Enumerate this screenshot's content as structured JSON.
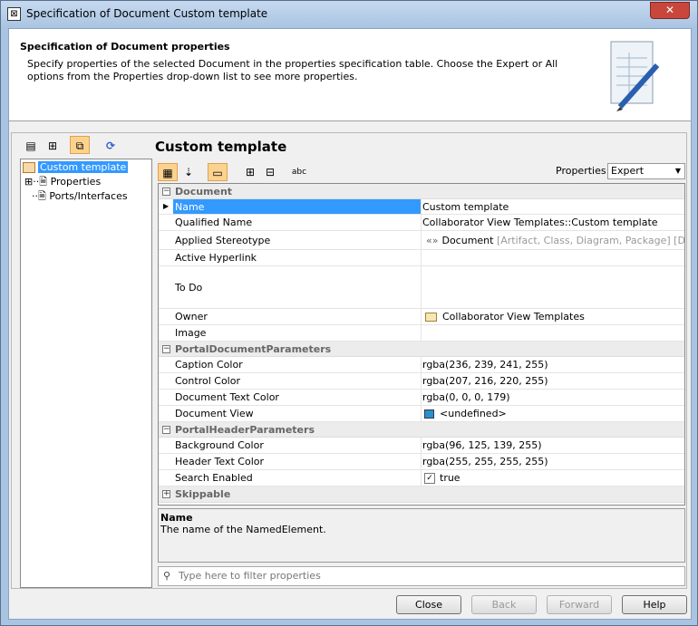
{
  "window": {
    "title": "Specification of Document Custom template",
    "close": "✕"
  },
  "header": {
    "title": "Specification of Document properties",
    "description": "Specify properties of the selected Document in the properties specification table. Choose the Expert or All options from the Properties drop-down list to see more properties."
  },
  "tree": {
    "items": [
      {
        "label": "Custom template"
      },
      {
        "label": "Properties"
      },
      {
        "label": "Ports/Interfaces"
      }
    ]
  },
  "panel": {
    "title": "Custom template",
    "properties_label": "Properties:",
    "properties_value": "Expert"
  },
  "groups": {
    "document": {
      "label": "Document",
      "rows": [
        {
          "name": "Name",
          "value": "Custom template"
        },
        {
          "name": "Qualified Name",
          "value": "Collaborator View Templates::Custom template"
        },
        {
          "name": "Applied Stereotype",
          "value": "Document",
          "value_extra": "[Artifact, Class, Diagram, Package] [Document]"
        },
        {
          "name": "Active Hyperlink",
          "value": ""
        },
        {
          "name": "To Do",
          "value": ""
        },
        {
          "name": "Owner",
          "value": "Collaborator View Templates"
        },
        {
          "name": "Image",
          "value": ""
        }
      ]
    },
    "portal_doc": {
      "label": "PortalDocumentParameters",
      "rows": [
        {
          "name": "Caption Color",
          "value": "rgba(236, 239, 241, 255)"
        },
        {
          "name": "Control Color",
          "value": "rgba(207, 216, 220, 255)"
        },
        {
          "name": "Document Text Color",
          "value": "rgba(0, 0, 0, 179)"
        },
        {
          "name": "Document View",
          "value": "<undefined>"
        }
      ]
    },
    "portal_header": {
      "label": "PortalHeaderParameters",
      "rows": [
        {
          "name": "Background Color",
          "value": "rgba(96, 125, 139, 255)"
        },
        {
          "name": "Header Text Color",
          "value": "rgba(255, 255, 255, 255)"
        },
        {
          "name": "Search Enabled",
          "value": "true",
          "checked": true
        }
      ]
    },
    "skippable": {
      "label": "Skippable"
    }
  },
  "description": {
    "title": "Name",
    "text": "The name of the NamedElement."
  },
  "filter": {
    "placeholder": "Type here to filter properties"
  },
  "buttons": {
    "close": "Close",
    "back": "Back",
    "forward": "Forward",
    "help": "Help"
  },
  "colors": {
    "selection": "#3399ff",
    "toggle_on": "#fbd38f"
  }
}
